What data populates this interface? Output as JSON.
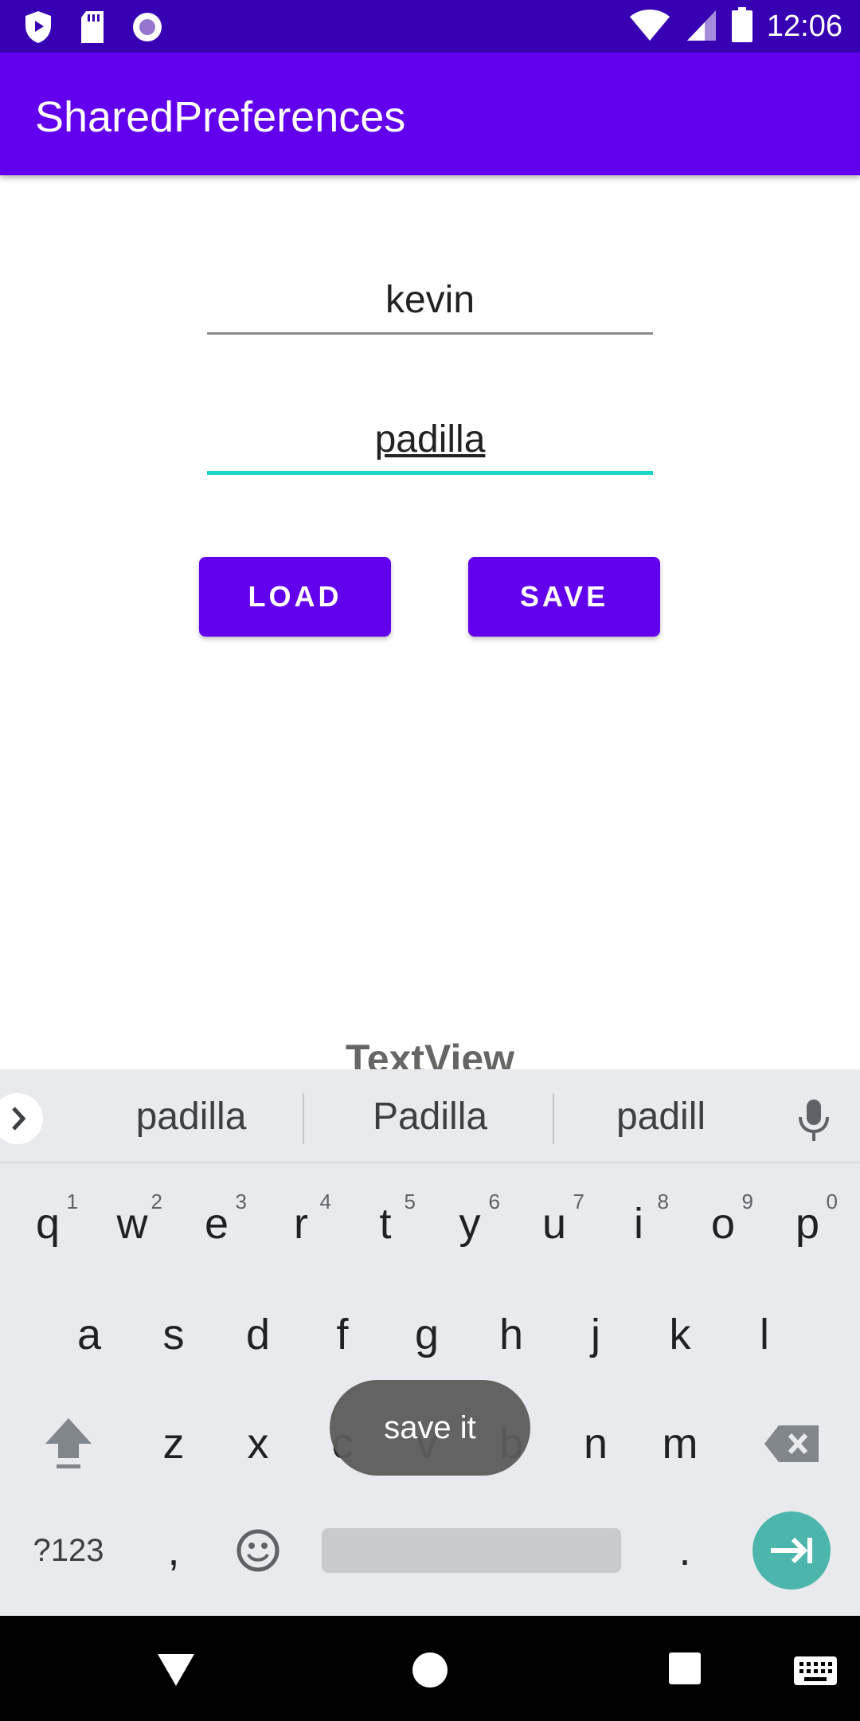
{
  "status_bar": {
    "time": "12:06",
    "icons": [
      "play-protect-icon",
      "sd-card-icon",
      "recording-icon",
      "wifi-icon",
      "signal-icon",
      "battery-icon"
    ]
  },
  "app_bar": {
    "title": "SharedPreferences"
  },
  "form": {
    "first_name_value": "kevin",
    "last_name_value": "padilla",
    "load_label": "LOAD",
    "save_label": "SAVE",
    "textview_label": "TextView"
  },
  "keyboard": {
    "suggestions": [
      "padilla",
      "Padilla",
      "padill"
    ],
    "row1": [
      {
        "key": "q",
        "hint": "1"
      },
      {
        "key": "w",
        "hint": "2"
      },
      {
        "key": "e",
        "hint": "3"
      },
      {
        "key": "r",
        "hint": "4"
      },
      {
        "key": "t",
        "hint": "5"
      },
      {
        "key": "y",
        "hint": "6"
      },
      {
        "key": "u",
        "hint": "7"
      },
      {
        "key": "i",
        "hint": "8"
      },
      {
        "key": "o",
        "hint": "9"
      },
      {
        "key": "p",
        "hint": "0"
      }
    ],
    "row2": [
      "a",
      "s",
      "d",
      "f",
      "g",
      "h",
      "j",
      "k",
      "l"
    ],
    "row3": [
      "z",
      "x",
      "c",
      "v",
      "b",
      "n",
      "m"
    ],
    "symbols_label": "?123",
    "comma_label": ",",
    "period_label": "."
  },
  "toast": {
    "message": "save it"
  },
  "colors": {
    "status_bar": "#3700b3",
    "primary": "#6200ee",
    "accent": "#18d8c3",
    "enter_key": "#4db6ac"
  }
}
